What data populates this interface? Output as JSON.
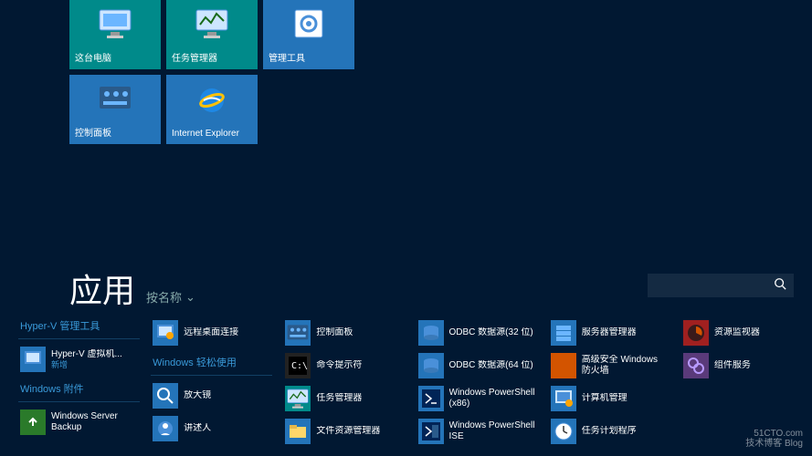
{
  "top_tiles": [
    {
      "label": "这台电脑",
      "bg": "bg-teal",
      "icon": "pc"
    },
    {
      "label": "任务管理器",
      "bg": "bg-teal",
      "icon": "taskmgr"
    },
    {
      "label": "管理工具",
      "bg": "bg-blue",
      "icon": "tools"
    },
    {
      "label": "控制面板",
      "bg": "bg-blue",
      "icon": "cpanel"
    },
    {
      "label": "Internet Explorer",
      "bg": "bg-blue2",
      "icon": "ie"
    }
  ],
  "apps": {
    "title": "应用",
    "sort_label": "按名称"
  },
  "search": {
    "placeholder": ""
  },
  "columns": [
    {
      "groups": [
        {
          "header": "Hyper-V 管理工具",
          "items": [
            {
              "label": "Hyper-V 虚拟机...",
              "sub": "新增",
              "icon": "hyperv",
              "bg": "ic-bg-blue"
            }
          ]
        },
        {
          "header": "Windows 附件",
          "items": [
            {
              "label": "Windows Server Backup",
              "icon": "backup",
              "bg": "ic-bg-green"
            }
          ]
        }
      ]
    },
    {
      "groups": [
        {
          "header": "",
          "items": [
            {
              "label": "远程桌面连接",
              "icon": "rdp",
              "bg": "ic-bg-blue"
            }
          ]
        },
        {
          "header": "Windows 轻松使用",
          "items": [
            {
              "label": "放大镜",
              "icon": "magnify",
              "bg": "ic-bg-blue"
            },
            {
              "label": "讲述人",
              "icon": "narrator",
              "bg": "ic-bg-blue"
            }
          ]
        }
      ]
    },
    {
      "groups": [
        {
          "header": "",
          "items": [
            {
              "label": "控制面板",
              "icon": "cpanel",
              "bg": "ic-bg-blue"
            },
            {
              "label": "命令提示符",
              "icon": "cmd",
              "bg": "ic-bg-dark"
            },
            {
              "label": "任务管理器",
              "icon": "taskmgr",
              "bg": "ic-bg-teal"
            },
            {
              "label": "文件资源管理器",
              "icon": "explorer",
              "bg": "ic-bg-blue"
            }
          ]
        }
      ]
    },
    {
      "groups": [
        {
          "header": "",
          "items": [
            {
              "label": "ODBC 数据源(32 位)",
              "icon": "odbc",
              "bg": "ic-bg-blue"
            },
            {
              "label": "ODBC 数据源(64 位)",
              "icon": "odbc",
              "bg": "ic-bg-blue"
            },
            {
              "label": "Windows PowerShell (x86)",
              "icon": "ps",
              "bg": "ic-bg-blue"
            },
            {
              "label": "Windows PowerShell ISE",
              "icon": "psise",
              "bg": "ic-bg-blue"
            }
          ]
        }
      ]
    },
    {
      "groups": [
        {
          "header": "",
          "items": [
            {
              "label": "服务器管理器",
              "icon": "servermgr",
              "bg": "ic-bg-blue"
            },
            {
              "label": "高级安全 Windows 防火墙",
              "icon": "firewall",
              "bg": "ic-bg-orange"
            },
            {
              "label": "计算机管理",
              "icon": "compmgmt",
              "bg": "ic-bg-blue"
            },
            {
              "label": "任务计划程序",
              "icon": "tasksched",
              "bg": "ic-bg-blue"
            }
          ]
        }
      ]
    },
    {
      "groups": [
        {
          "header": "",
          "items": [
            {
              "label": "资源监视器",
              "icon": "resmon",
              "bg": "ic-bg-red"
            },
            {
              "label": "组件服务",
              "icon": "compsvc",
              "bg": "ic-bg-purple"
            }
          ]
        }
      ]
    }
  ],
  "watermark": {
    "line1": "51CTO.com",
    "line2": "技术博客 Blog"
  }
}
